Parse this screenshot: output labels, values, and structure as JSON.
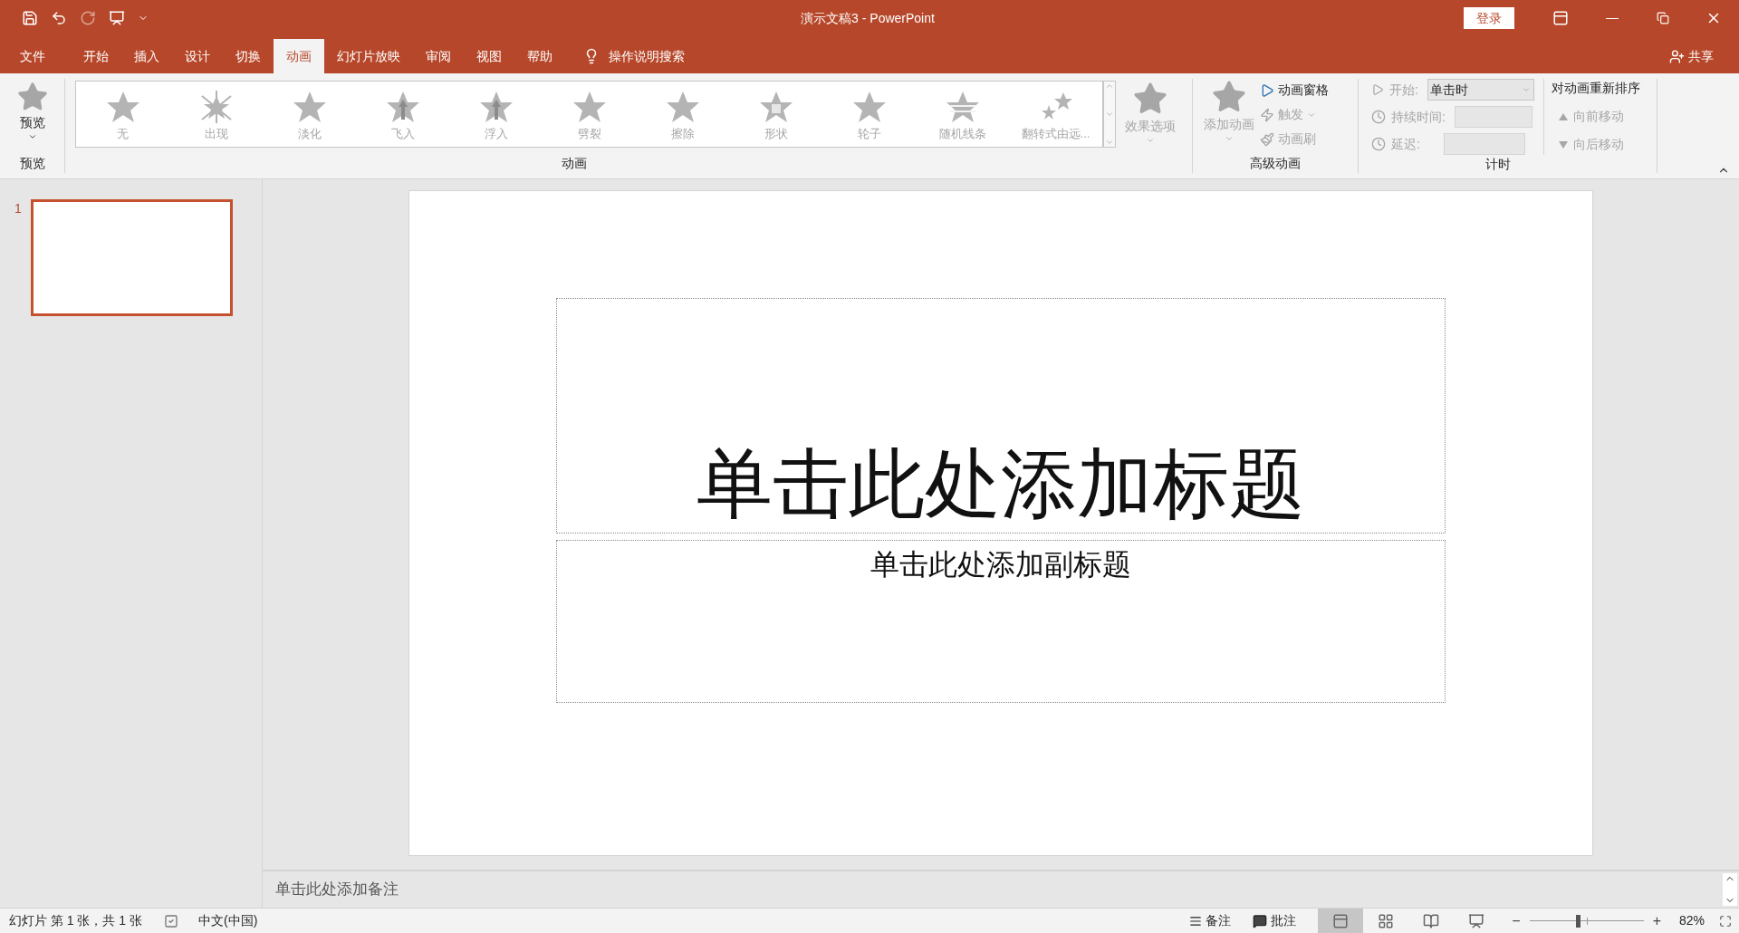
{
  "window": {
    "title": "演示文稿3 - PowerPoint",
    "sign_in": "登录"
  },
  "tabs": [
    {
      "label": "文件",
      "selected": false
    },
    {
      "label": "开始",
      "selected": false
    },
    {
      "label": "插入",
      "selected": false
    },
    {
      "label": "设计",
      "selected": false
    },
    {
      "label": "切换",
      "selected": false
    },
    {
      "label": "动画",
      "selected": true
    },
    {
      "label": "幻灯片放映",
      "selected": false
    },
    {
      "label": "审阅",
      "selected": false
    },
    {
      "label": "视图",
      "selected": false
    },
    {
      "label": "帮助",
      "selected": false
    }
  ],
  "tell_me": "操作说明搜索",
  "share": "共享",
  "ribbon": {
    "preview": {
      "label": "预览",
      "group": "预览"
    },
    "animations": {
      "group": "动画",
      "effect_options": "效果选项",
      "items": [
        {
          "label": "无",
          "kind": "plain"
        },
        {
          "label": "出现",
          "kind": "burst"
        },
        {
          "label": "淡化",
          "kind": "plain"
        },
        {
          "label": "飞入",
          "kind": "arrow"
        },
        {
          "label": "浮入",
          "kind": "arrow"
        },
        {
          "label": "劈裂",
          "kind": "plain"
        },
        {
          "label": "擦除",
          "kind": "plain"
        },
        {
          "label": "形状",
          "kind": "square"
        },
        {
          "label": "轮子",
          "kind": "plain"
        },
        {
          "label": "随机线条",
          "kind": "lines"
        },
        {
          "label": "翻转式由远...",
          "kind": "double"
        }
      ]
    },
    "advanced": {
      "group": "高级动画",
      "add": {
        "label": "添加动画",
        "disabled": true
      },
      "pane": {
        "label": "动画窗格",
        "disabled": false
      },
      "trigger": {
        "label": "触发",
        "disabled": true
      },
      "painter": {
        "label": "动画刷",
        "disabled": true
      }
    },
    "timing": {
      "group": "计时",
      "start": {
        "label": "开始:",
        "value": "单击时"
      },
      "duration": {
        "label": "持续时间:"
      },
      "delay": {
        "label": "延迟:"
      }
    },
    "reorder": {
      "title": "对动画重新排序",
      "earlier": "向前移动",
      "later": "向后移动"
    }
  },
  "slides": [
    {
      "number": "1",
      "selected": true
    }
  ],
  "slide": {
    "title_placeholder": "单击此处添加标题",
    "subtitle_placeholder": "单击此处添加副标题"
  },
  "notes_placeholder": "单击此处添加备注",
  "status_bar": {
    "slide_info": "幻灯片 第 1 张，共 1 张",
    "language": "中文(中国)",
    "notes": "备注",
    "comments": "批注",
    "views": [
      {
        "kind": "normal",
        "selected": true
      },
      {
        "kind": "sorter",
        "selected": false
      },
      {
        "kind": "reading",
        "selected": false
      },
      {
        "kind": "show",
        "selected": false
      }
    ],
    "zoom": {
      "minus": "−",
      "plus": "+",
      "level": 0.41,
      "reading": "82%"
    }
  }
}
